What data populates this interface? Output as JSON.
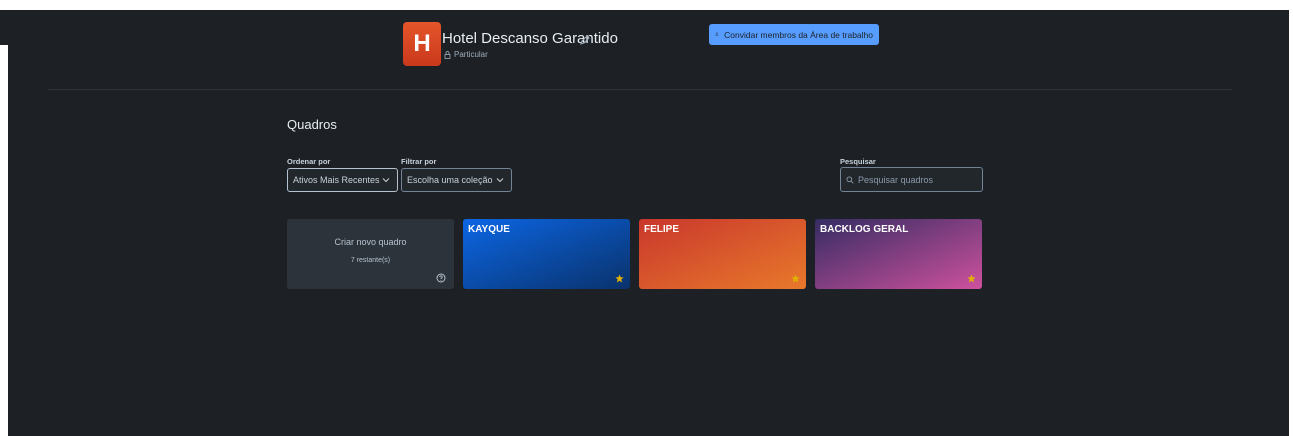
{
  "workspace": {
    "initial": "H",
    "name": "Hotel Descanso Garantido",
    "visibility": "Particular"
  },
  "invite_button": "Convidar membros da Área de trabalho",
  "section_title": "Quadros",
  "sort": {
    "label": "Ordenar por",
    "value": "Ativos Mais Recentes"
  },
  "filter": {
    "label": "Filtrar por",
    "value": "Escolha uma coleção"
  },
  "search": {
    "label": "Pesquisar",
    "placeholder": "Pesquisar quadros"
  },
  "create_board": {
    "title": "Criar novo quadro",
    "remaining": "7 restante(s)"
  },
  "boards": [
    {
      "title": "KAYQUE",
      "colors": [
        "#0c66e4",
        "#09326c"
      ],
      "starred": true
    },
    {
      "title": "FELIPE",
      "colors": [
        "#c9372c",
        "#e8792b"
      ],
      "starred": true
    },
    {
      "title": "BACKLOG GERAL",
      "colors": [
        "#352c63",
        "#cd519d"
      ],
      "starred": true
    }
  ],
  "colors": {
    "background": "#1d2125",
    "accent": "#579dff",
    "star": "#e2b203"
  },
  "icons": [
    "pencil-icon",
    "lock-icon",
    "add-person-icon",
    "chevron-down-icon",
    "search-icon",
    "star-icon",
    "help-icon"
  ]
}
